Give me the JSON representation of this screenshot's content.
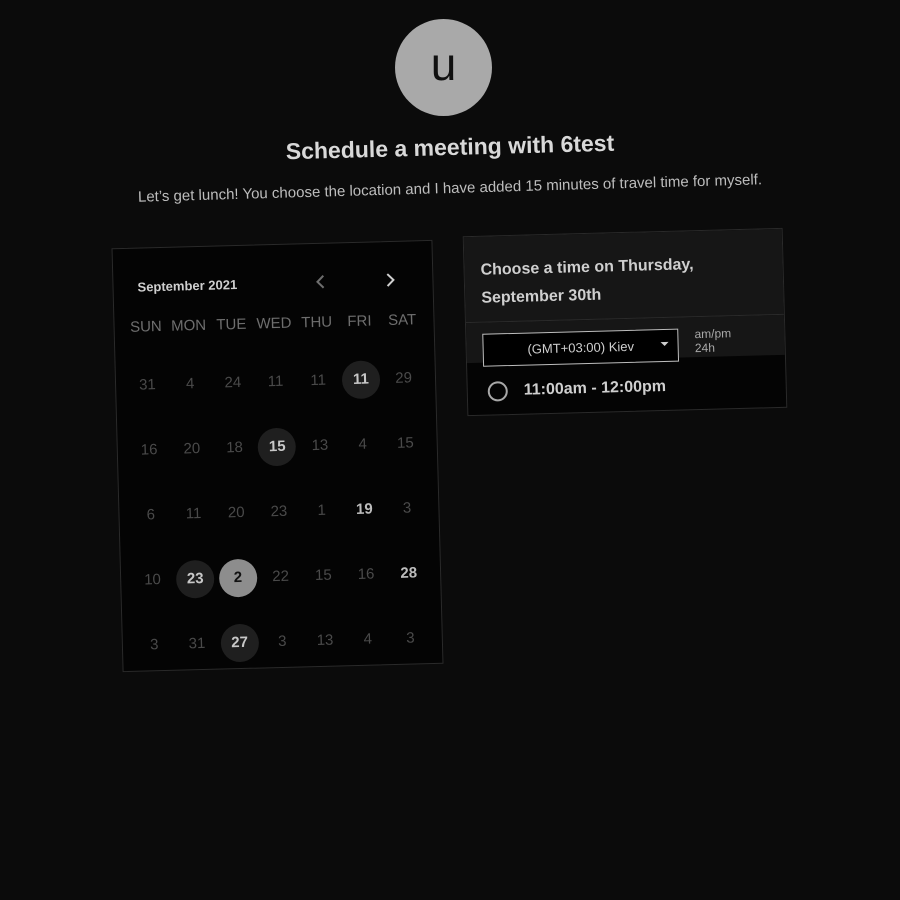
{
  "header": {
    "avatar_letter": "u",
    "title": "Schedule a meeting with 6test",
    "subtitle": "Let’s get lunch! You choose the location and I have added 15 minutes of travel time for myself."
  },
  "calendar": {
    "month_label": "September 2021",
    "prev_icon": "chevron-left-icon",
    "next_icon": "chevron-right-icon",
    "weekdays": [
      "SUN",
      "MON",
      "TUE",
      "WED",
      "THU",
      "FRI",
      "SAT"
    ],
    "days": [
      [
        "31",
        "4",
        "24",
        "11",
        "11",
        "11",
        "29"
      ],
      [
        "16",
        "20",
        "18",
        "15",
        "13",
        "4",
        "15"
      ],
      [
        "6",
        "11",
        "20",
        "23",
        "1",
        "19",
        "3"
      ],
      [
        "10",
        "23",
        "2",
        "22",
        "15",
        "16",
        "28"
      ],
      [
        "3",
        "31",
        "27",
        "3",
        "13",
        "4",
        "3"
      ]
    ],
    "available": [
      "0.5",
      "1.3",
      "3.1",
      "4.2"
    ],
    "bold": [
      "2.5",
      "3.6"
    ],
    "selected": "3.2"
  },
  "time_panel": {
    "heading_line1": "Choose a time on Thursday,",
    "heading_line2": "September 30th",
    "timezone": "(GMT+03:00) Kiev",
    "format_ampm": "am/pm",
    "format_24h": "24h",
    "slots": [
      "11:00am - 12:00pm"
    ]
  },
  "colors": {
    "background": "#0b0b0b",
    "card": "#040404",
    "selected_day": "#8d8d8d",
    "available_day": "#1f1f1f"
  }
}
